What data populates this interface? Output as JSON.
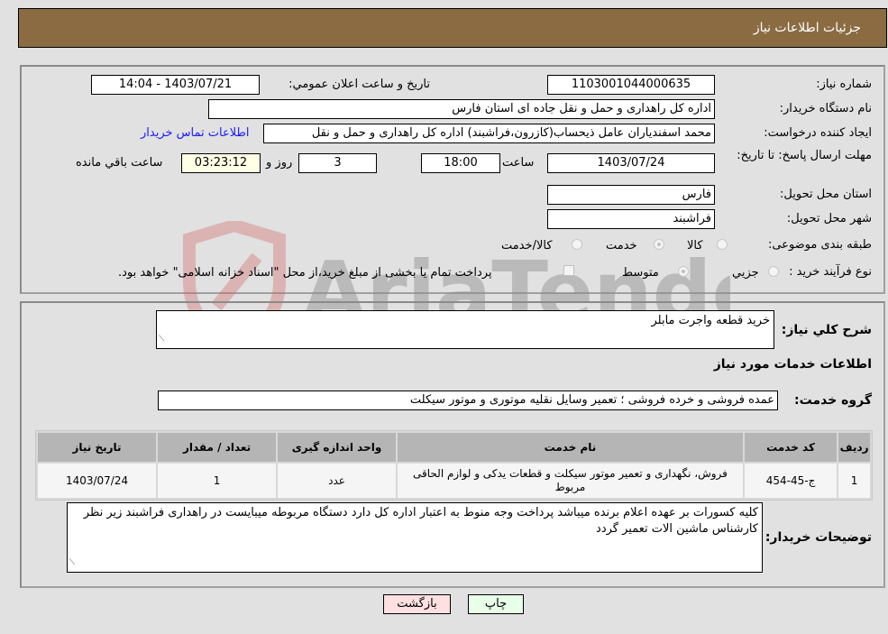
{
  "header": {
    "title": "جزئیات اطلاعات نیاز"
  },
  "form": {
    "need_number": {
      "label": "شماره نیاز:",
      "value": "1103001044000635"
    },
    "announce_datetime": {
      "label": "تاريخ و ساعت اعلان عمومي:",
      "value": "1403/07/21 - 14:04"
    },
    "buyer_org": {
      "label": "نام دستگاه خريدار:",
      "value": "اداره کل راهداری و حمل و نقل جاده ای استان فارس"
    },
    "requester": {
      "label": "ایجاد کننده درخواست:",
      "value": "محمد اسفندیاران عامل ذیحساب(کازرون،فراشبند) اداره کل راهداری و حمل و نقل",
      "contact_link": "اطلاعات تماس خريدار"
    },
    "deadline": {
      "label": "مهلت ارسال پاسخ: تا تاریخ:",
      "date": "1403/07/24",
      "time_label": "ساعت",
      "time": "18:00",
      "days": "3",
      "days_label": "روز و",
      "remaining": "03:23:12",
      "remaining_label": "ساعت باقي مانده"
    },
    "delivery_province": {
      "label": "استان محل تحویل:",
      "value": "فارس"
    },
    "delivery_city": {
      "label": "شهر محل تحویل:",
      "value": "فراشبند"
    },
    "category": {
      "label": "طبقه بندی موضوعی:",
      "options": [
        {
          "label": "کالا",
          "selected": false
        },
        {
          "label": "خدمت",
          "selected": true
        },
        {
          "label": "کالا/خدمت",
          "selected": false
        }
      ]
    },
    "purchase_type": {
      "label": "نوع فرآیند خرید :",
      "options": [
        {
          "label": "جزيي",
          "selected": false
        },
        {
          "label": "متوسط",
          "selected": true
        }
      ],
      "treasury_checkbox": {
        "label": "پرداخت تمام يا بخشی از مبلغ خريد،از محل \"اسناد خزانه اسلامی\" خواهد بود.",
        "checked": false
      }
    }
  },
  "details": {
    "summary_label": "شرح کلي نياز:",
    "summary_value": "خريد قطعه واجرت مابلر",
    "services_title": "اطلاعات خدمات مورد نياز",
    "service_group_label": "گروه خدمت:",
    "service_group_value": "عمده فروشی و خرده فروشی ؛ تعمیر وسایل نقلیه موتوری و موتور سیکلت",
    "table": {
      "headers": [
        "رديف",
        "کد خدمت",
        "نام خدمت",
        "واحد اندازه گيری",
        "تعداد / مقدار",
        "تاريخ نياز"
      ],
      "rows": [
        [
          "1",
          "ج-45-454",
          "فروش، نگهداری و تعمیر موتور سیکلت و قطعات یدکی و لوازم الحاقی مربوط",
          "عدد",
          "1",
          "1403/07/24"
        ]
      ]
    },
    "buyer_notes_label": "توضيحات خريدار:",
    "buyer_notes_value": "کلیه کسورات بر عهده اعلام برنده میباشد پرداخت وجه منوط به اعتبار اداره کل دارد دستگاه مربوطه میبایست در راهداری فراشبند زیر نظر کارشناس ماشین الات تعمیر گردد"
  },
  "buttons": {
    "print": "چاپ",
    "back": "بازگشت"
  },
  "watermark": {
    "text": "AriaTender.neT"
  },
  "colors": {
    "header_bg": "#8b6c42",
    "print_bg": "#e8ffe8",
    "back_bg": "#ffe0e0",
    "link": "#1a1aff"
  }
}
